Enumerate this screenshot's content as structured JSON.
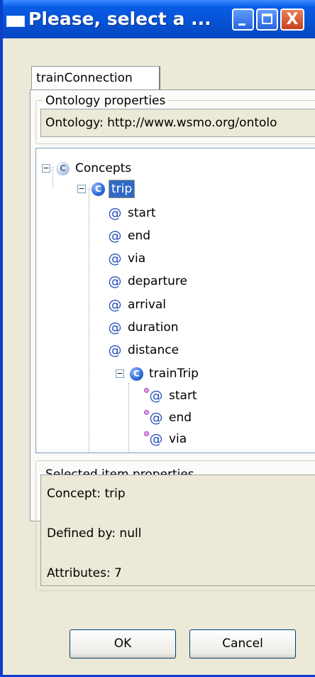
{
  "window": {
    "title": "Please, select a ...",
    "minimize_label": "",
    "maximize_label": "",
    "close_label": "X"
  },
  "tabs": [
    {
      "label": "trainConnection",
      "selected": true
    }
  ],
  "ontology_properties": {
    "group_label": "Ontology properties",
    "value": "Ontology: http://www.wsmo.org/ontolo"
  },
  "tree": {
    "root": {
      "label": "Concepts",
      "expander": "−"
    },
    "concept": {
      "label": "trip",
      "expander": "−",
      "selected": true
    },
    "attributes": [
      "start",
      "end",
      "via",
      "departure",
      "arrival",
      "duration",
      "distance"
    ],
    "subconcept": {
      "label": "trainTrip",
      "expander": "−"
    },
    "inherited_attributes": [
      "start",
      "end",
      "via"
    ]
  },
  "selected_item_properties": {
    "group_label": "Selected item properties",
    "concept": "Concept: trip",
    "defined_by": "Defined by: null",
    "attributes": "Attributes: 7"
  },
  "buttons": {
    "ok": "OK",
    "cancel": "Cancel"
  },
  "icons": {
    "concept": "concept-c-icon",
    "attribute": "attribute-at-icon"
  }
}
